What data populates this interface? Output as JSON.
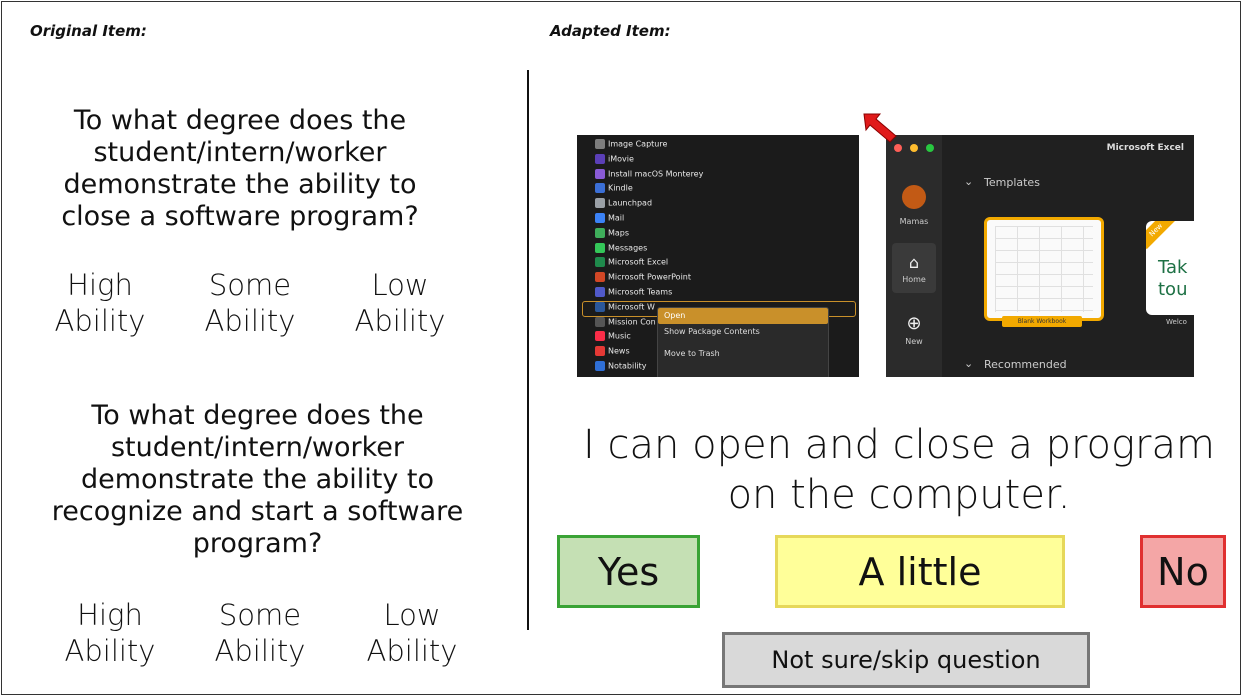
{
  "left": {
    "header": "Original Item:",
    "q1": [
      "To what degree does the",
      "student/intern/worker",
      "demonstrate the ability to",
      "close a software program?"
    ],
    "q1_options": [
      [
        "High",
        "Ability"
      ],
      [
        "Some",
        "Ability"
      ],
      [
        "Low",
        "Ability"
      ]
    ],
    "q2": [
      "To what degree does the",
      "student/intern/worker",
      "demonstrate the ability to",
      "recognize and start a software",
      "program?"
    ],
    "q2_options": [
      [
        "High",
        "Ability"
      ],
      [
        "Some",
        "Ability"
      ],
      [
        "Low",
        "Ability"
      ]
    ]
  },
  "right": {
    "header": "Adapted Item:",
    "screenshot": {
      "apps": [
        "Image Capture",
        "iMovie",
        "Install macOS Monterey",
        "Kindle",
        "Launchpad",
        "Mail",
        "Maps",
        "Messages",
        "Microsoft Excel",
        "Microsoft PowerPoint",
        "Microsoft Teams",
        "Microsoft W",
        "Mission Con",
        "Music",
        "News",
        "Notability"
      ],
      "app_colors": [
        "#7d7d7d",
        "#5b3fb7",
        "#8a5bd6",
        "#3b6fd6",
        "#9aa0a6",
        "#3b82f6",
        "#3fae5b",
        "#34c759",
        "#1f8a4c",
        "#d24726",
        "#5059c9",
        "#2b579a",
        "#555",
        "#fa2d48",
        "#e53935",
        "#2f6fd6"
      ],
      "menu": [
        "Open",
        "Show Package Contents",
        "Move to Trash"
      ],
      "excel_title": "Microsoft Excel",
      "templates_label": "Templates",
      "recommended_label": "Recommended",
      "sidebar": [
        "Home",
        "New"
      ],
      "user_label": "Mamas",
      "blank_workbook_label": "Blank Workbook",
      "take_tour": [
        "Tak",
        "tou"
      ],
      "new_badge": "New",
      "welcome_label": "Welco"
    },
    "statement": [
      "I can open and close a program",
      "on the computer."
    ],
    "buttons": {
      "yes": "Yes",
      "a_little": "A little",
      "no": "No",
      "skip": "Not sure/skip question"
    }
  }
}
